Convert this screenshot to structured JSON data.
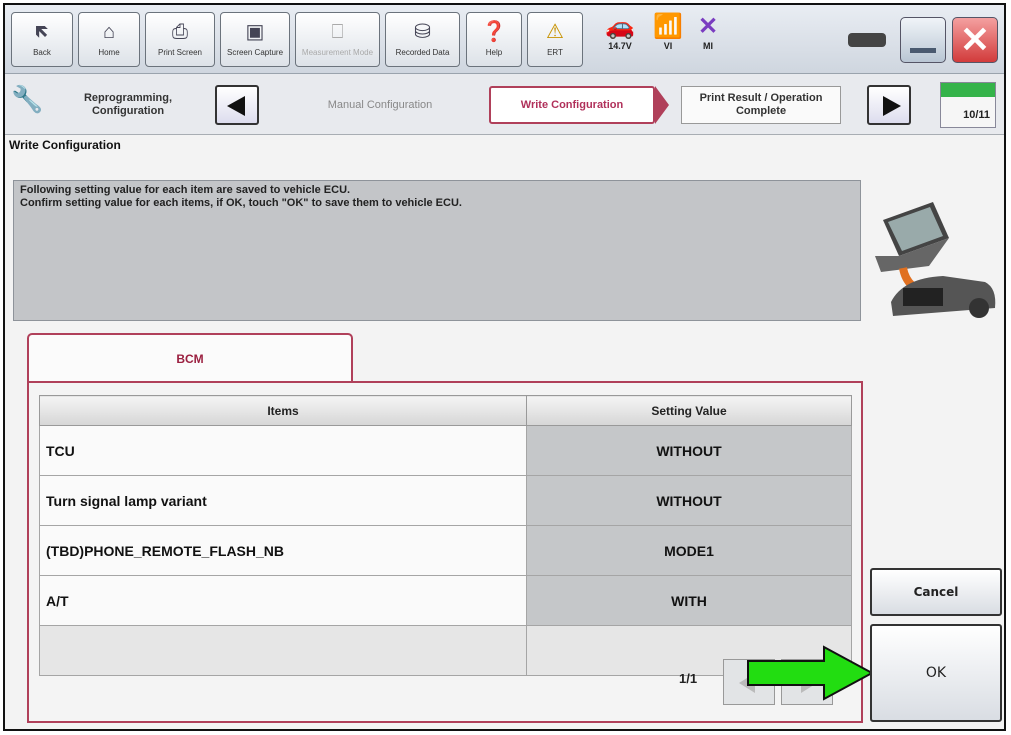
{
  "toolbar": {
    "back": "Back",
    "home": "Home",
    "print_screen": "Print Screen",
    "screen_capture": "Screen Capture",
    "measurement_mode": "Measurement Mode",
    "recorded_data": "Recorded Data",
    "help": "Help",
    "ert": "ERT",
    "voltage": "14.7V",
    "vi": "VI",
    "mi": "MI"
  },
  "steps": {
    "reprogramming": "Reprogramming, Configuration",
    "manual_config": "Manual Configuration",
    "write_config": "Write Configuration",
    "print_result": "Print Result / Operation Complete",
    "page": "10/11"
  },
  "section_title": "Write Configuration",
  "message": {
    "line1": "Following setting value for each item are saved to vehicle ECU.",
    "line2": "Confirm setting value for each items, if OK, touch \"OK\" to save them to vehicle ECU."
  },
  "tab": {
    "label": "BCM"
  },
  "table": {
    "col_items": "Items",
    "col_value": "Setting Value",
    "rows": [
      {
        "item": "TCU",
        "value": "WITHOUT"
      },
      {
        "item": "Turn signal lamp variant",
        "value": "WITHOUT"
      },
      {
        "item": "(TBD)PHONE_REMOTE_FLASH_NB",
        "value": "MODE1"
      },
      {
        "item": "A/T",
        "value": "WITH"
      }
    ]
  },
  "pager": {
    "text": "1/1"
  },
  "buttons": {
    "cancel": "Cancel",
    "ok": "OK"
  },
  "colors": {
    "accent": "#b0405a",
    "arrow": "#22dd11",
    "progress": "#35b34a"
  }
}
